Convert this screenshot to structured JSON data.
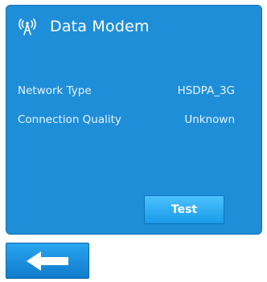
{
  "header": {
    "title": "Data Modem",
    "icon": "antenna-signal-icon"
  },
  "rows": [
    {
      "label": "Network Type",
      "value": "HSDPA_3G"
    },
    {
      "label": "Connection Quality",
      "value": "Unknown"
    }
  ],
  "actions": {
    "test_label": "Test",
    "back_icon": "back-arrow-icon"
  },
  "colors": {
    "panel": "#1e8ed8",
    "button": "#1a9be8",
    "text": "#ffffff"
  }
}
